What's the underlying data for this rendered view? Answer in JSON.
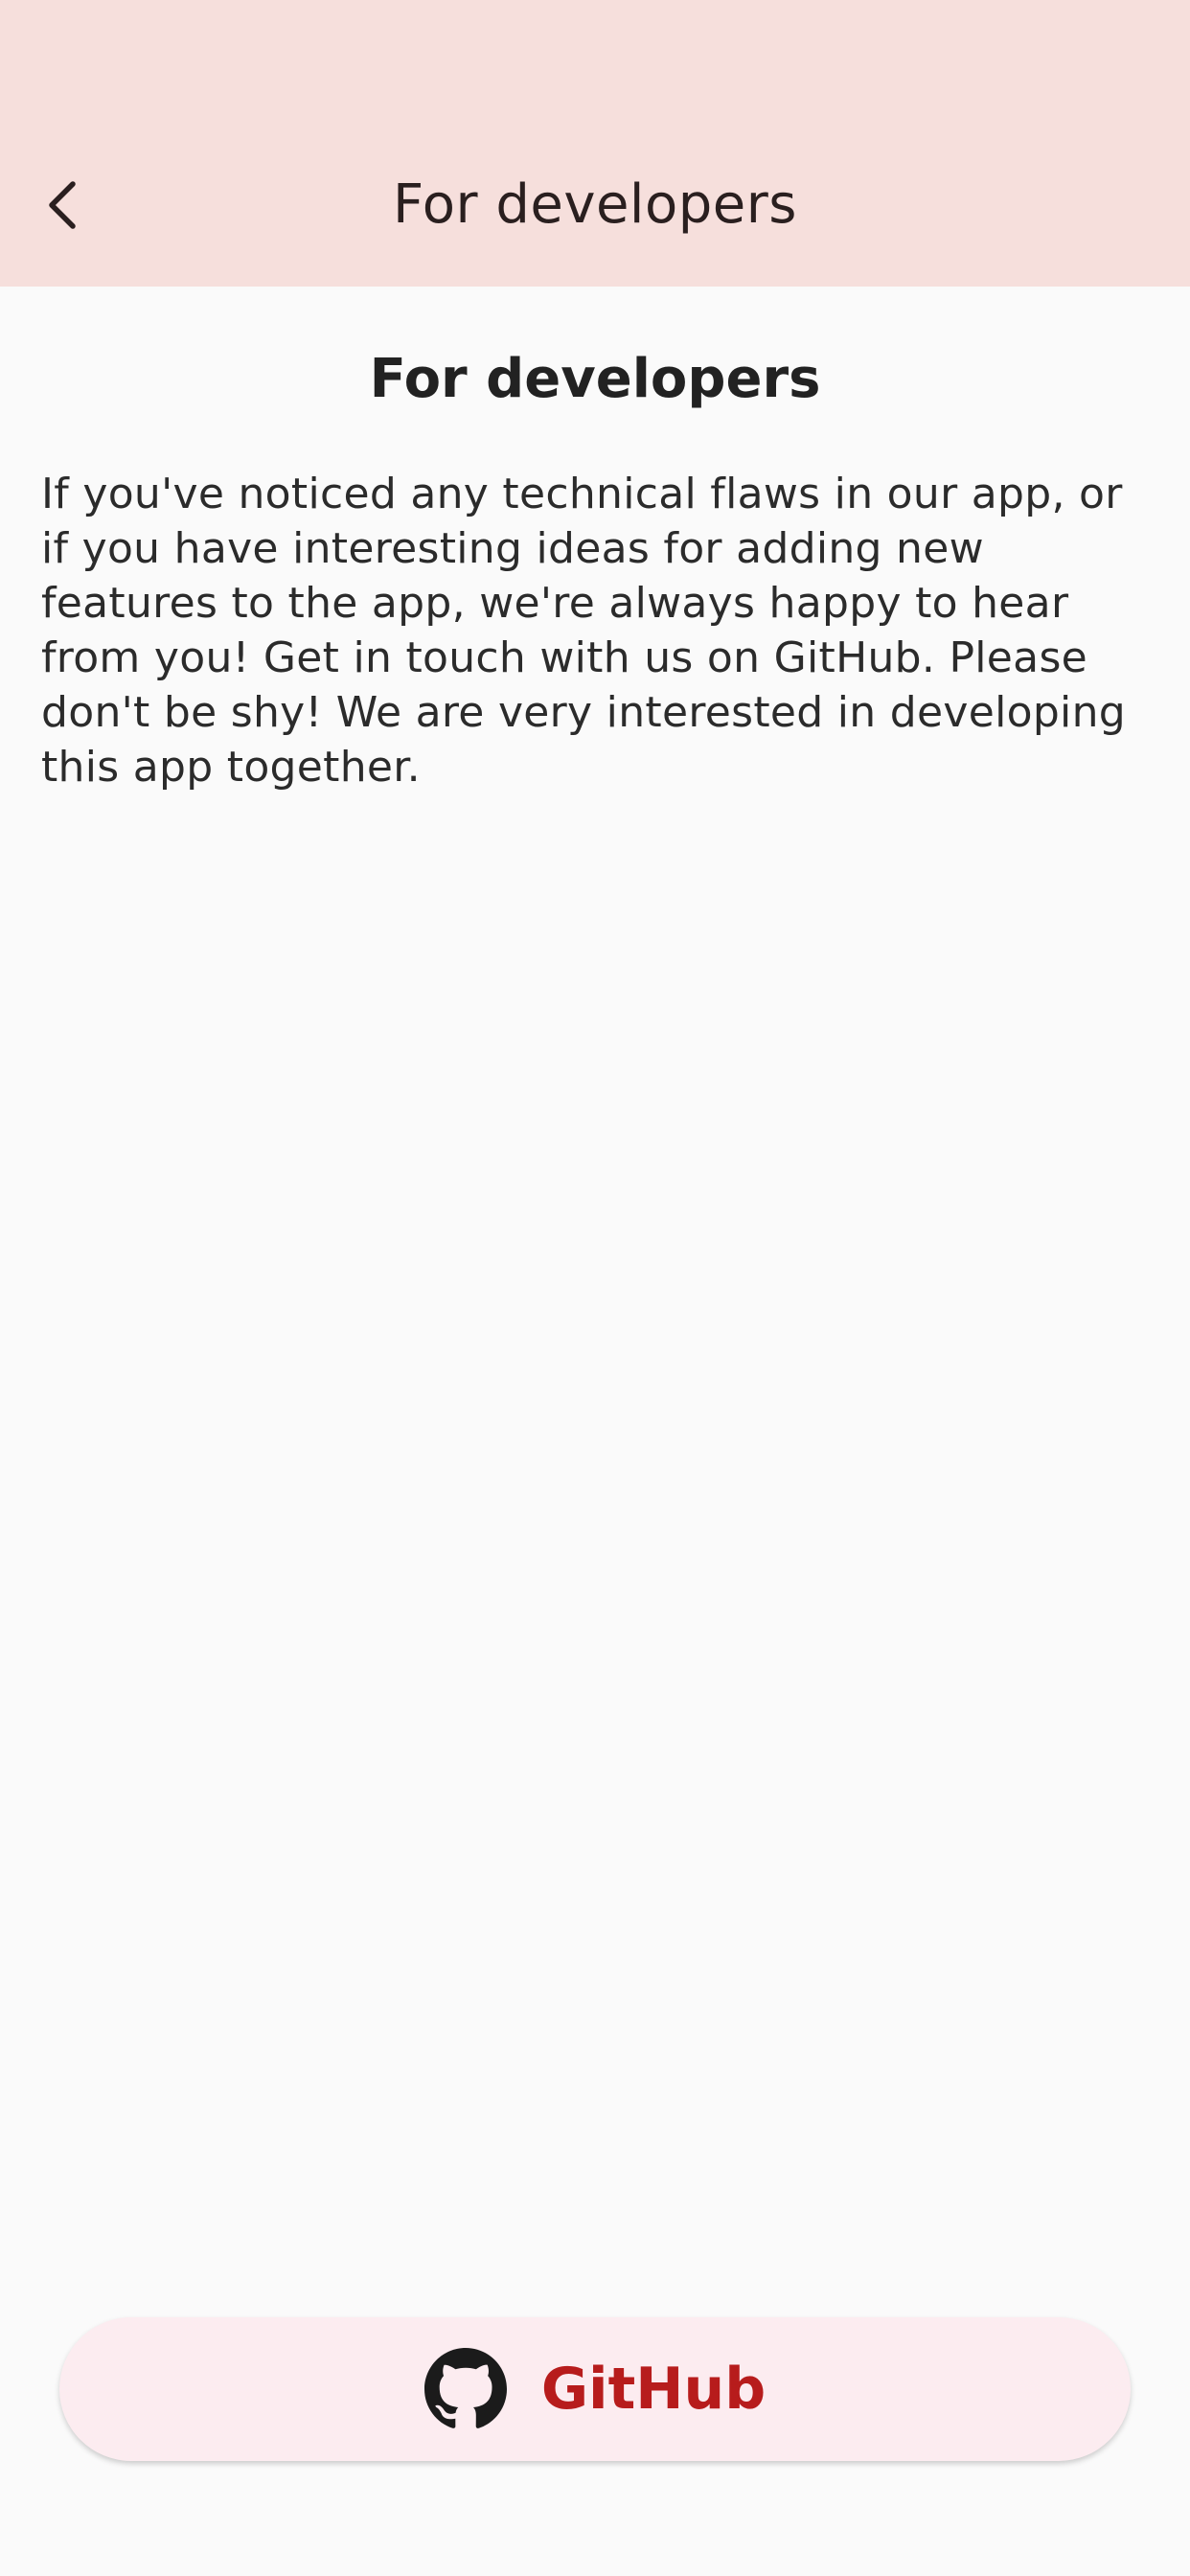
{
  "colors": {
    "appbar_bg": "#f6dfdc",
    "page_bg": "#fafafa",
    "button_bg": "#fcecf0",
    "button_text": "#b71c1c"
  },
  "appbar": {
    "back_icon": "chevron-left-icon",
    "title": "For developers"
  },
  "main": {
    "heading": "For developers",
    "body": "If you've noticed any technical flaws in our app, or if you have interesting ideas for adding new features to the app, we're always happy to hear from you! Get in touch with us on GitHub. Please don't be shy! We are very interested in developing this app together."
  },
  "github_button": {
    "icon": "github-icon",
    "label": "GitHub"
  }
}
